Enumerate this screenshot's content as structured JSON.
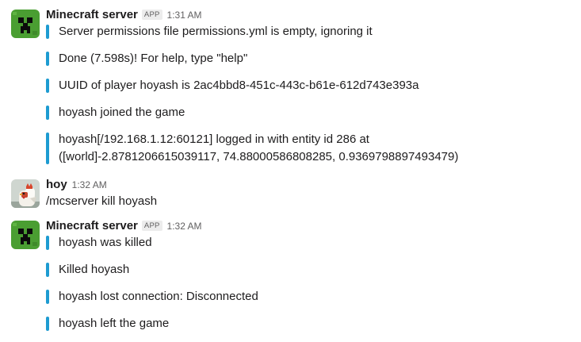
{
  "messages": [
    {
      "sender": "Minecraft server",
      "badge": "APP",
      "time": "1:31 AM",
      "avatar_icon": "creeper-icon",
      "quotes": [
        [
          "Server permissions file permissions.yml is empty, ignoring it"
        ],
        [
          "Done (7.598s)! For help, type \"help\""
        ],
        [
          "UUID of player hoyash is 2ac4bbd8-451c-443c-b61e-612d743e393a"
        ],
        [
          "hoyash joined the game"
        ],
        [
          "hoyash[/192.168.1.12:60121] logged in with entity id 286 at",
          "([world]-2.8781206615039117, 74.88000586808285, 0.9369798897493479)"
        ]
      ]
    },
    {
      "sender": "hoy",
      "time": "1:32 AM",
      "avatar_icon": "chicken-icon",
      "text": "/mcserver kill hoyash"
    },
    {
      "sender": "Minecraft server",
      "badge": "APP",
      "time": "1:32 AM",
      "avatar_icon": "creeper-icon",
      "quotes": [
        [
          "hoyash was killed"
        ],
        [
          "Killed hoyash"
        ],
        [
          "hoyash lost connection: Disconnected"
        ],
        [
          "hoyash left the game"
        ]
      ]
    }
  ],
  "colors": {
    "quote_bar": "#1d9bd1",
    "creeper_green": "#4a9e32",
    "text": "#1d1c1d",
    "muted": "#616061"
  }
}
